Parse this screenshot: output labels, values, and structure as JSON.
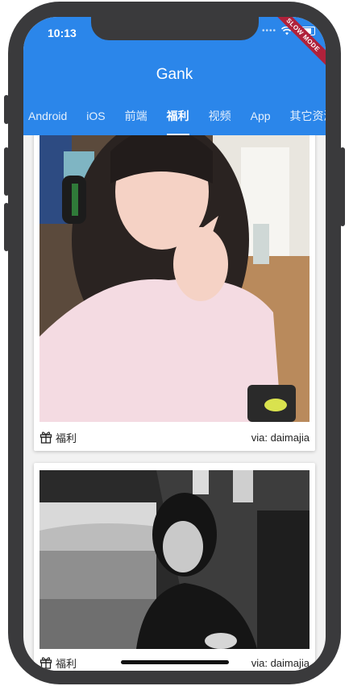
{
  "status_bar": {
    "time": "10:13",
    "debug_banner": "SLOW MODE"
  },
  "app_bar": {
    "title": "Gank"
  },
  "tabs": [
    {
      "label": "Android"
    },
    {
      "label": "iOS"
    },
    {
      "label": "前端"
    },
    {
      "label": "福利"
    },
    {
      "label": "视频"
    },
    {
      "label": "App"
    },
    {
      "label": "其它资源"
    }
  ],
  "active_tab": "福利",
  "feed": [
    {
      "category": "福利",
      "via": "via: daimajia",
      "icon": "gift-icon"
    },
    {
      "category": "福利",
      "via": "via: daimajia",
      "icon": "gift-icon"
    }
  ],
  "colors": {
    "app_bar": "#2b86ea",
    "debug_banner": "#b0223b"
  }
}
